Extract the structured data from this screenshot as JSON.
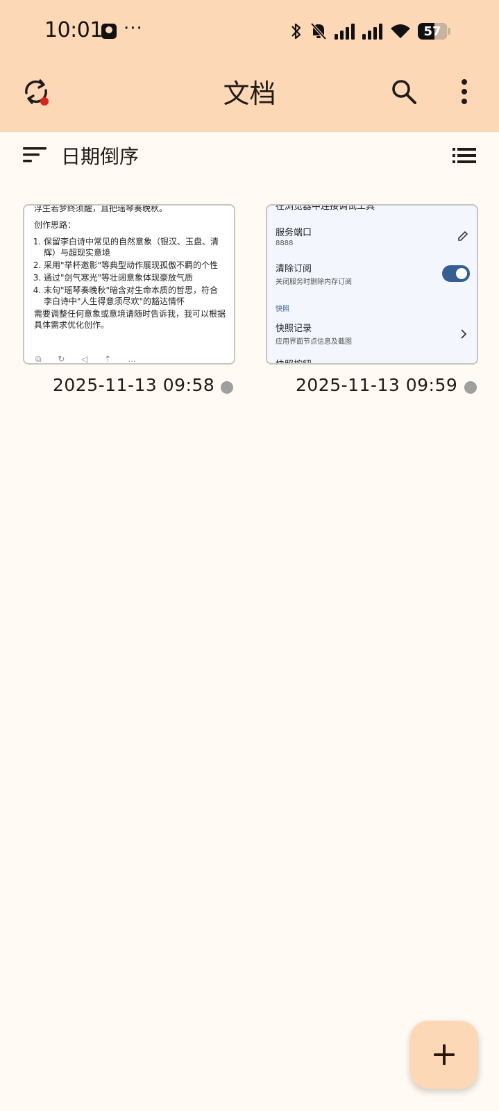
{
  "status_bar": {
    "time": "10:01",
    "more": "···",
    "battery": "57"
  },
  "app_bar": {
    "title": "文档"
  },
  "sort": {
    "label": "日期倒序"
  },
  "documents": [
    {
      "date": "2025-11-13 09:58",
      "preview": {
        "line1": "浮生若梦终须醒，且把瑶琴奏晚秋。",
        "line2": "创作思路：",
        "items": [
          "保留李白诗中常见的自然意象（银汉、玉盘、清辉）与超现实意境",
          "采用\"举杯邀影\"等典型动作展现孤傲不羁的个性",
          "通过\"剑气寒光\"等壮阔意象体现豪放气质",
          "末句\"瑶琴奏晚秋\"暗含对生命本质的哲思，符合李白诗中\"人生得意须尽欢\"的豁达情怀"
        ],
        "footer": "需要调整任何意象或意境请随时告诉我，我可以根据具体需求优化创作。"
      }
    },
    {
      "date": "2025-11-13 09:59",
      "preview": {
        "top_partial": "在浏览器中连接调试工具",
        "port_title": "服务端口",
        "port_value": "8888",
        "clear_title": "清除订阅",
        "clear_sub": "关闭服务时删除内存订阅",
        "section": "快照",
        "snap_title": "快照记录",
        "snap_sub": "应用界面节点信息及截图",
        "bottom_partial": "快照按钮"
      }
    }
  ],
  "colors": {
    "app_bar_bg": "#fdd8b7",
    "page_bg": "#fffaf4",
    "sync_badge": "#d9231d",
    "status_dot": "#9f9f9f",
    "toggle_on": "#355f92"
  },
  "icons": {
    "sync": "sync-icon",
    "search": "search-icon",
    "more": "more-vertical-icon",
    "sort": "sort-icon",
    "view": "list-view-icon",
    "add": "add-icon"
  }
}
